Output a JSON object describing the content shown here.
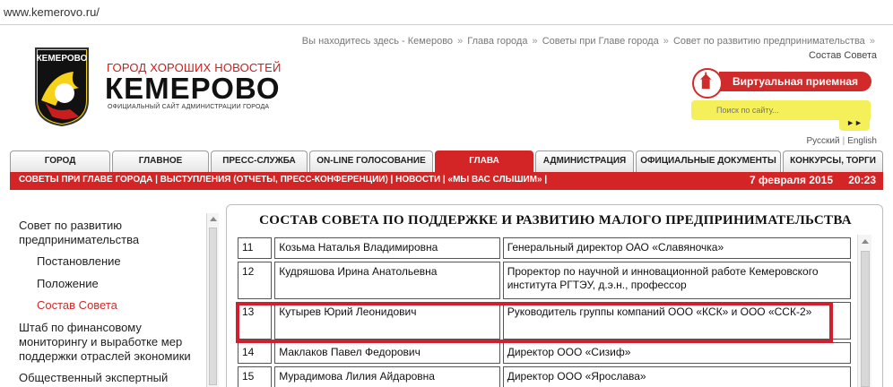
{
  "browser": {
    "url": "www.kemerovo.ru/"
  },
  "header": {
    "logo_text": "КЕМЕРОВО",
    "subtitle": "ГОРОД ХОРОШИХ НОВОСТЕЙ",
    "title": "КЕМЕРОВО",
    "tagline": "ОФИЦИАЛЬНЫЙ САЙТ АДМИНИСТРАЦИИ ГОРОДА"
  },
  "breadcrumb": {
    "prefix": "Вы находитесь здесь - ",
    "items": [
      "Кемерово",
      "Глава города",
      "Советы при Главе города",
      "Совет по развитию предпринимательства"
    ],
    "separator": "»",
    "current": "Состав Совета"
  },
  "virtual_reception": {
    "label": "Виртуальная приемная"
  },
  "search": {
    "placeholder": "Поиск по сайту...",
    "go_label": "►►"
  },
  "languages": [
    "Русский",
    "English"
  ],
  "main_menu": [
    "ГОРОД",
    "ГЛАВНОЕ",
    "ПРЕСС-СЛУЖБА",
    "ON-LINE ГОЛОСОВАНИЕ",
    "ГЛАВА",
    "АДМИНИСТРАЦИЯ",
    "ОФИЦИАЛЬНЫЕ ДОКУМЕНТЫ",
    "КОНКУРСЫ, ТОРГИ"
  ],
  "active_menu": "ГЛАВА",
  "sub_menu": {
    "links": "СОВЕТЫ ПРИ ГЛАВЕ ГОРОДА | ВЫСТУПЛЕНИЯ (ОТЧЕТЫ, ПРЕСС-КОНФЕРЕНЦИИ) | НОВОСТИ | «МЫ ВАС СЛЫШИМ» |",
    "date": "7 февраля 2015",
    "time": "20:23"
  },
  "sidebar": {
    "items": [
      {
        "label": "Совет по развитию предпринимательства",
        "level": 0
      },
      {
        "label": "Постановление",
        "level": 1
      },
      {
        "label": "Положение",
        "level": 1
      },
      {
        "label": "Состав Совета",
        "level": 1,
        "active": true
      },
      {
        "label": "Штаб по финансовому мониторингу и выработке мер поддержки отраслей экономики",
        "level": 0
      },
      {
        "label": "Общественный экспертный",
        "level": 0
      }
    ]
  },
  "content": {
    "title": "СОСТАВ СОВЕТА ПО ПОДДЕРЖКЕ И РАЗВИТИЮ МАЛОГО ПРЕДПРИНИМАТЕЛЬСТВА",
    "rows": [
      {
        "num": "11",
        "name": "Козьма Наталья Владимировна",
        "position": "Генеральный директор ОАО «Славяночка»"
      },
      {
        "num": "12",
        "name": "Кудряшова Ирина Анатольевна",
        "position": "Проректор по научной и инновационной работе Кемеровского института РГТЭУ, д.э.н., профессор"
      },
      {
        "num": "13",
        "name": "Кутырев Юрий Леонидович",
        "position": "Руководитель группы компаний ООО «КСК» и ООО «ССК-2»",
        "highlighted": true
      },
      {
        "num": "14",
        "name": "Маклаков Павел Федорович",
        "position": "Директор ООО «Сизиф»"
      },
      {
        "num": "15",
        "name": "Мурадимова Лилия Айдаровна",
        "position": "Директор ООО «Ярослава»"
      }
    ]
  },
  "colors": {
    "accent_red": "#d32525",
    "highlight_red": "#d11f2f",
    "search_yellow": "#f5f05a"
  }
}
